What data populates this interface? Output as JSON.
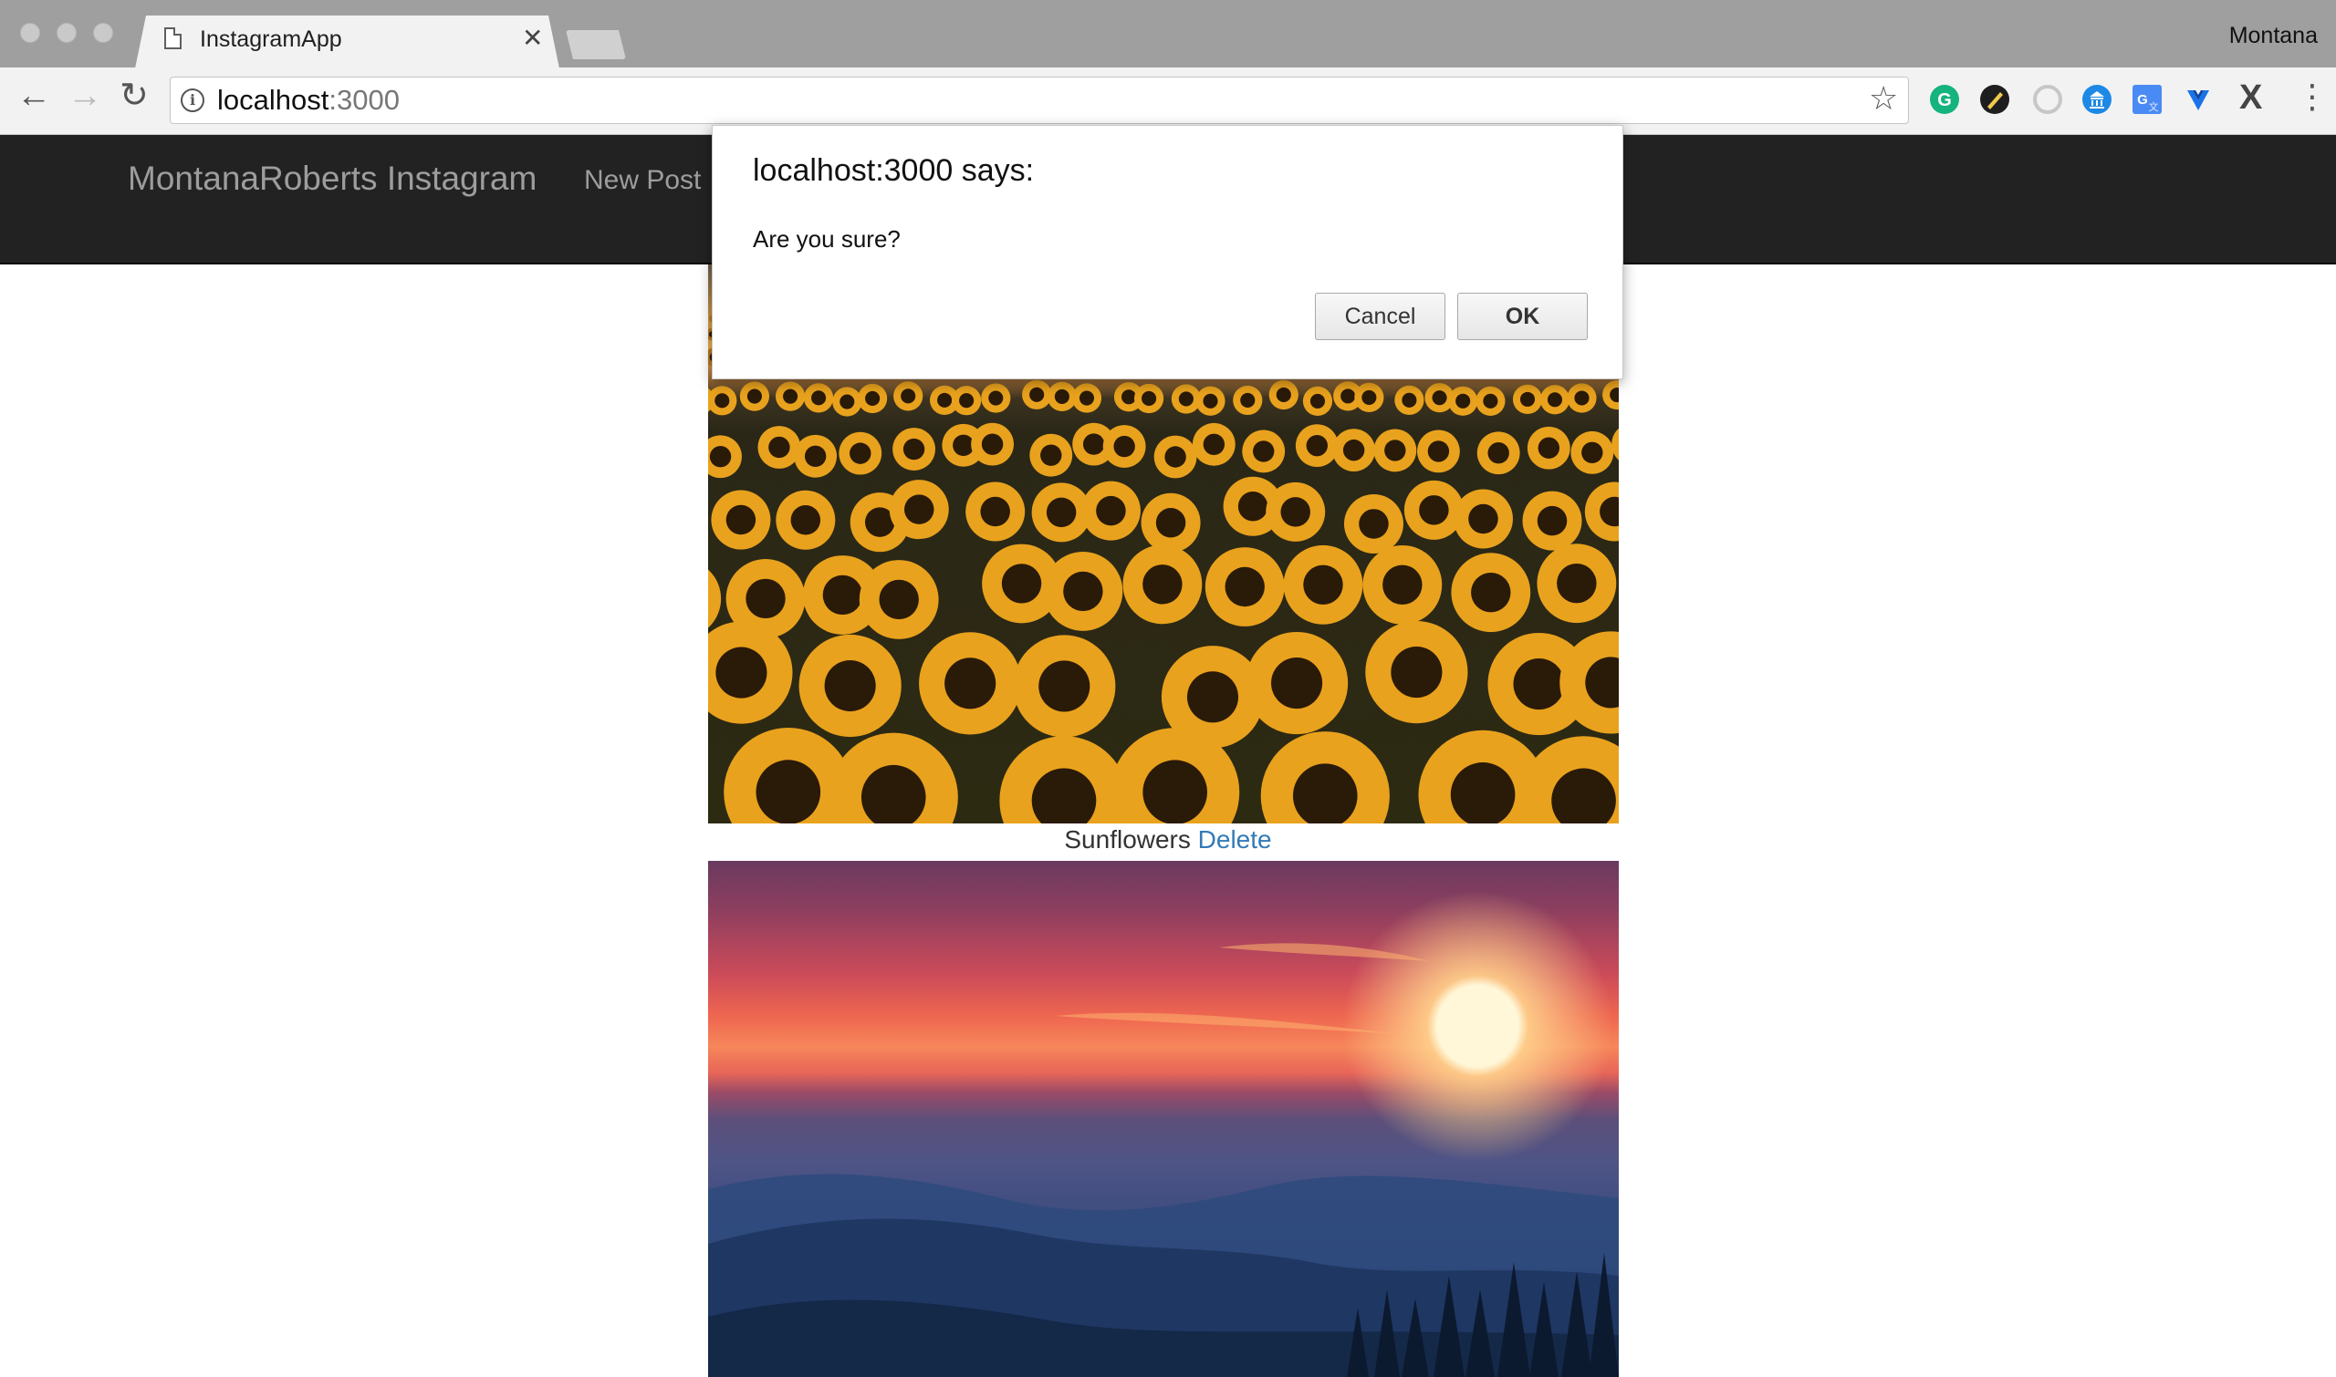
{
  "browser": {
    "tab_title": "InstagramApp",
    "profile_name": "Montana",
    "url_host": "localhost",
    "url_port": ":3000",
    "icons": [
      "back-arrow-icon",
      "forward-arrow-icon",
      "reload-icon",
      "info-icon",
      "bookmark-star-icon",
      "grammarly-icon",
      "extension-icon",
      "loading-ring-icon",
      "bank-icon",
      "google-translate-icon",
      "vue-devtools-icon",
      "x-extension-icon",
      "menu-kebab-icon"
    ]
  },
  "navbar": {
    "brand": "MontanaRoberts Instagram",
    "new_post": "New Post"
  },
  "posts": [
    {
      "caption": "Sunflowers",
      "delete_label": "Delete",
      "image": "sunflower-field"
    },
    {
      "caption": "",
      "image": "mountain-sunset"
    }
  ],
  "dialog": {
    "title": "localhost:3000 says:",
    "message": "Are you sure?",
    "cancel_label": "Cancel",
    "ok_label": "OK"
  },
  "colors": {
    "navbar_bg": "#222222",
    "nav_text": "#9d9d9d",
    "link": "#337ab7",
    "chrome_tabstrip": "#9f9f9f",
    "chrome_toolbar": "#f2f2f2"
  }
}
